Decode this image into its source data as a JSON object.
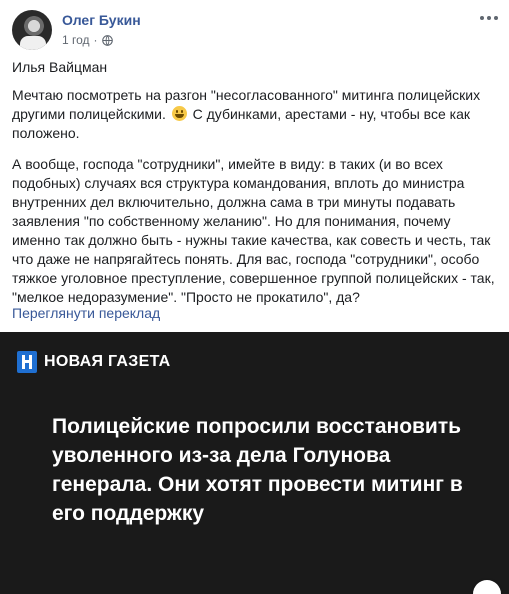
{
  "post": {
    "author": "Олег Букин",
    "time": "1 год",
    "separator": "·",
    "signature": "Илья Вайцман",
    "paragraph1_a": "Мечтаю посмотреть на разгон \"несогласованного\" митинга полицейских другими полицейскими.",
    "paragraph1_b": "С дубинками, арестами - ну, чтобы все как положено.",
    "paragraph2": "А вообще, господа \"сотрудники\", имейте в виду: в таких (и во всех подобных) случаях вся структура командования, вплоть до министра внутренних дел включительно, должна сама в три минуты подавать заявления \"по собственному желанию\". Но для понимания, почему именно так должно быть - нужны такие качества, как совесть и честь, так что даже не напрягайтесь понять. Для вас, господа \"сотрудники\", особо тяжкое уголовное преступление, совершенное группой полицейских - так, \"мелкое недоразумение\". \"Просто не прокатило\", да?",
    "translate_link": "Переглянути переклад"
  },
  "news_card": {
    "brand": "НОВАЯ ГАЗЕТА",
    "headline": "Полицейские попросили восстановить уволенного из-за дела Голунова генерала. Они хотят провести митинг в его поддержку"
  },
  "icons": {
    "privacy": "globe-icon",
    "menu": "more-icon",
    "emoji": "smile-emoji-icon"
  },
  "colors": {
    "link": "#385898",
    "card_background": "#1a1a1a",
    "brand_blue": "#1f6fd1"
  }
}
